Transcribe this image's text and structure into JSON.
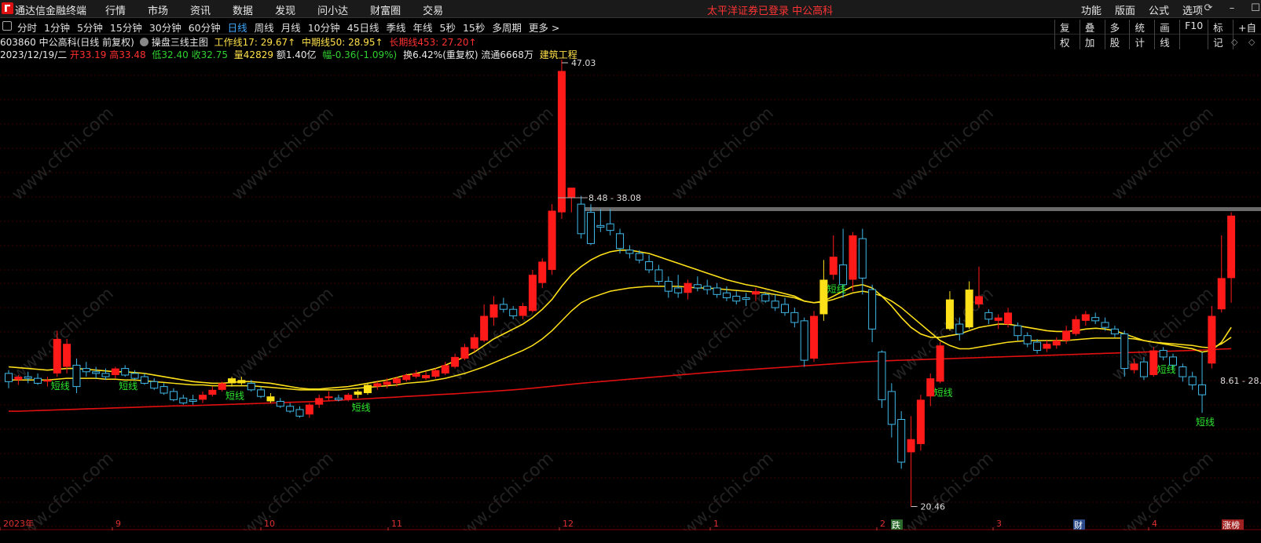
{
  "app": {
    "title": "通达信金融终端"
  },
  "main_menu": [
    "行情",
    "市场",
    "资讯",
    "数据",
    "发现",
    "问小达",
    "财富圈",
    "交易"
  ],
  "notice": "太平洋证券已登录  中公高科",
  "right_menu": [
    "功能",
    "版面",
    "公式",
    "选项"
  ],
  "period_tabs": [
    "分时",
    "1分钟",
    "5分钟",
    "15分钟",
    "30分钟",
    "60分钟",
    "日线",
    "周线",
    "月线",
    "10分钟",
    "45日线",
    "季线",
    "年线",
    "5秒",
    "15秒",
    "多周期",
    "更多 >"
  ],
  "active_period": "日线",
  "tool_buttons": [
    "复权",
    "叠加",
    "多股",
    "统计",
    "画线",
    "F10",
    "标记",
    "+自"
  ],
  "stock": {
    "code_name": "603860 中公高科(日线 前复权)",
    "indicator": "操盘三线主图",
    "work_line": "工作线17: 29.67↑",
    "mid_line": "中期线50: 28.95↑",
    "long_line": "长期线453: 27.20↑",
    "date": "2023/12/19/二",
    "open": "开33.19",
    "high": "高33.48",
    "low": "低32.40",
    "close": "收32.75",
    "volume": "量42829",
    "amount": "额1.40亿",
    "change": "幅-0.36(-1.09%)",
    "turnover": "换6.42%(重复权)",
    "float": "流通6668万",
    "sector": "建筑工程"
  },
  "annotations": {
    "high_mark": "47.03",
    "low_mark": "20.46",
    "range_top": "8.48 - 38.08",
    "range_right": "8.61 - 28.",
    "short_line": "短线"
  },
  "x_labels": [
    "2023年",
    "9",
    "10",
    "11",
    "12",
    "1",
    "2",
    "3",
    "4"
  ],
  "event_badges": [
    "跌",
    "财",
    "涨榜"
  ],
  "watermark": "www.cfchi.com",
  "colors": {
    "up": "#ff1a1a",
    "down": "#3fb8e8",
    "yellow": "#ffe11a",
    "long_line": "#e01010",
    "short_label": "#2ee82e"
  },
  "chart_data": {
    "type": "candlestick",
    "ylim": [
      20.0,
      47.5
    ],
    "candles": [
      {
        "o": 28.6,
        "h": 28.8,
        "l": 27.7,
        "c": 28.1
      },
      {
        "o": 28.2,
        "h": 28.5,
        "l": 27.9,
        "c": 28.4
      },
      {
        "o": 28.4,
        "h": 28.7,
        "l": 28.0,
        "c": 28.3
      },
      {
        "o": 28.3,
        "h": 28.6,
        "l": 27.9,
        "c": 28.0
      },
      {
        "o": 28.1,
        "h": 28.4,
        "l": 27.8,
        "c": 28.2
      },
      {
        "o": 28.6,
        "h": 31.2,
        "l": 28.4,
        "c": 30.7
      },
      {
        "o": 29.0,
        "h": 30.7,
        "l": 28.6,
        "c": 30.4
      },
      {
        "o": 29.1,
        "h": 29.5,
        "l": 27.4,
        "c": 27.8
      },
      {
        "o": 28.9,
        "h": 29.3,
        "l": 28.4,
        "c": 28.7
      },
      {
        "o": 28.7,
        "h": 29.0,
        "l": 28.3,
        "c": 28.6
      },
      {
        "o": 28.6,
        "h": 28.9,
        "l": 28.2,
        "c": 28.4
      },
      {
        "o": 28.5,
        "h": 29.0,
        "l": 28.3,
        "c": 28.9
      },
      {
        "o": 28.9,
        "h": 29.1,
        "l": 28.4,
        "c": 28.5
      },
      {
        "o": 28.6,
        "h": 28.8,
        "l": 28.2,
        "c": 28.3
      },
      {
        "o": 28.4,
        "h": 28.6,
        "l": 27.9,
        "c": 28.0
      },
      {
        "o": 28.1,
        "h": 28.3,
        "l": 27.6,
        "c": 27.7
      },
      {
        "o": 27.8,
        "h": 28.0,
        "l": 27.3,
        "c": 27.4
      },
      {
        "o": 27.5,
        "h": 27.7,
        "l": 26.9,
        "c": 27.0
      },
      {
        "o": 27.1,
        "h": 27.3,
        "l": 26.7,
        "c": 26.8
      },
      {
        "o": 27.0,
        "h": 27.3,
        "l": 26.7,
        "c": 26.9
      },
      {
        "o": 27.0,
        "h": 27.5,
        "l": 26.8,
        "c": 27.3
      },
      {
        "o": 27.3,
        "h": 27.8,
        "l": 27.2,
        "c": 27.6
      },
      {
        "o": 27.6,
        "h": 28.1,
        "l": 27.5,
        "c": 28.0
      },
      {
        "o": 28.0,
        "h": 28.4,
        "l": 27.8,
        "c": 28.3
      },
      {
        "o": 28.2,
        "h": 28.4,
        "l": 27.9,
        "c": 28.0
      },
      {
        "o": 28.0,
        "h": 28.2,
        "l": 27.5,
        "c": 27.6
      },
      {
        "o": 27.6,
        "h": 27.8,
        "l": 27.1,
        "c": 27.2
      },
      {
        "o": 27.2,
        "h": 27.4,
        "l": 26.8,
        "c": 26.9
      },
      {
        "o": 26.9,
        "h": 27.1,
        "l": 26.5,
        "c": 26.6
      },
      {
        "o": 26.6,
        "h": 26.8,
        "l": 26.2,
        "c": 26.3
      },
      {
        "o": 26.4,
        "h": 26.6,
        "l": 25.9,
        "c": 26.0
      },
      {
        "o": 26.1,
        "h": 26.8,
        "l": 25.9,
        "c": 26.7
      },
      {
        "o": 26.7,
        "h": 27.3,
        "l": 26.5,
        "c": 27.1
      },
      {
        "o": 27.1,
        "h": 27.5,
        "l": 26.9,
        "c": 27.2
      },
      {
        "o": 27.1,
        "h": 27.3,
        "l": 26.9,
        "c": 27.0
      },
      {
        "o": 27.0,
        "h": 27.4,
        "l": 26.9,
        "c": 27.3
      },
      {
        "o": 27.3,
        "h": 27.6,
        "l": 27.1,
        "c": 27.5
      },
      {
        "o": 27.4,
        "h": 28.0,
        "l": 27.3,
        "c": 27.9
      },
      {
        "o": 27.8,
        "h": 28.1,
        "l": 27.6,
        "c": 28.0
      },
      {
        "o": 27.9,
        "h": 28.3,
        "l": 27.7,
        "c": 28.1
      },
      {
        "o": 28.0,
        "h": 28.4,
        "l": 27.8,
        "c": 28.3
      },
      {
        "o": 28.2,
        "h": 28.6,
        "l": 28.1,
        "c": 28.5
      },
      {
        "o": 28.4,
        "h": 28.8,
        "l": 28.3,
        "c": 28.6
      },
      {
        "o": 28.3,
        "h": 28.7,
        "l": 28.2,
        "c": 28.5
      },
      {
        "o": 28.4,
        "h": 28.9,
        "l": 28.3,
        "c": 28.8
      },
      {
        "o": 28.6,
        "h": 29.3,
        "l": 28.5,
        "c": 29.1
      },
      {
        "o": 29.0,
        "h": 29.8,
        "l": 28.9,
        "c": 29.6
      },
      {
        "o": 29.5,
        "h": 30.4,
        "l": 29.4,
        "c": 30.2
      },
      {
        "o": 30.1,
        "h": 31.0,
        "l": 29.9,
        "c": 30.8
      },
      {
        "o": 30.6,
        "h": 32.8,
        "l": 30.5,
        "c": 32.1
      },
      {
        "o": 32.0,
        "h": 33.3,
        "l": 31.5,
        "c": 32.8
      },
      {
        "o": 32.8,
        "h": 33.2,
        "l": 32.3,
        "c": 32.5
      },
      {
        "o": 32.5,
        "h": 32.7,
        "l": 31.9,
        "c": 32.1
      },
      {
        "o": 32.1,
        "h": 32.9,
        "l": 31.9,
        "c": 32.7
      },
      {
        "o": 32.4,
        "h": 34.9,
        "l": 32.3,
        "c": 34.6
      },
      {
        "o": 34.1,
        "h": 35.6,
        "l": 33.8,
        "c": 35.4
      },
      {
        "o": 34.9,
        "h": 38.9,
        "l": 34.6,
        "c": 38.5
      },
      {
        "o": 38.4,
        "h": 48.5,
        "l": 38.0,
        "c": 47.0
      },
      {
        "o": 39.3,
        "h": 39.9,
        "l": 38.4,
        "c": 39.9
      },
      {
        "o": 38.9,
        "h": 39.4,
        "l": 36.8,
        "c": 37.1
      },
      {
        "o": 38.4,
        "h": 38.9,
        "l": 36.4,
        "c": 36.5
      },
      {
        "o": 37.6,
        "h": 38.6,
        "l": 37.2,
        "c": 37.5
      },
      {
        "o": 37.7,
        "h": 38.6,
        "l": 37.0,
        "c": 37.3
      },
      {
        "o": 37.1,
        "h": 37.4,
        "l": 35.9,
        "c": 36.2
      },
      {
        "o": 36.1,
        "h": 36.4,
        "l": 35.6,
        "c": 35.9
      },
      {
        "o": 35.9,
        "h": 36.1,
        "l": 35.3,
        "c": 35.5
      },
      {
        "o": 35.4,
        "h": 35.8,
        "l": 34.7,
        "c": 34.9
      },
      {
        "o": 34.9,
        "h": 35.2,
        "l": 34.0,
        "c": 34.2
      },
      {
        "o": 34.2,
        "h": 34.5,
        "l": 33.2,
        "c": 33.6
      },
      {
        "o": 33.8,
        "h": 34.6,
        "l": 33.2,
        "c": 33.5
      },
      {
        "o": 33.5,
        "h": 34.3,
        "l": 33.1,
        "c": 34.1
      },
      {
        "o": 34.0,
        "h": 34.5,
        "l": 33.6,
        "c": 33.8
      },
      {
        "o": 33.9,
        "h": 34.3,
        "l": 33.4,
        "c": 33.7
      },
      {
        "o": 33.8,
        "h": 34.1,
        "l": 33.2,
        "c": 33.4
      },
      {
        "o": 33.5,
        "h": 33.9,
        "l": 33.0,
        "c": 33.2
      },
      {
        "o": 33.3,
        "h": 33.6,
        "l": 32.8,
        "c": 33.0
      },
      {
        "o": 33.2,
        "h": 33.5,
        "l": 32.7,
        "c": 33.1
      },
      {
        "o": 33.4,
        "h": 33.8,
        "l": 33.0,
        "c": 33.6
      },
      {
        "o": 33.4,
        "h": 33.5,
        "l": 32.9,
        "c": 33.0
      },
      {
        "o": 33.0,
        "h": 33.4,
        "l": 32.4,
        "c": 32.6
      },
      {
        "o": 32.8,
        "h": 33.2,
        "l": 32.1,
        "c": 32.3
      },
      {
        "o": 32.3,
        "h": 32.6,
        "l": 31.4,
        "c": 31.7
      },
      {
        "o": 31.8,
        "h": 32.0,
        "l": 29.0,
        "c": 29.4
      },
      {
        "o": 29.5,
        "h": 32.4,
        "l": 29.3,
        "c": 32.1
      },
      {
        "o": 32.2,
        "h": 35.5,
        "l": 31.8,
        "c": 34.3
      },
      {
        "o": 34.6,
        "h": 37.0,
        "l": 34.3,
        "c": 35.7
      },
      {
        "o": 35.2,
        "h": 37.4,
        "l": 33.2,
        "c": 34.0
      },
      {
        "o": 34.3,
        "h": 37.2,
        "l": 33.6,
        "c": 37.0
      },
      {
        "o": 36.8,
        "h": 37.4,
        "l": 33.4,
        "c": 34.4
      },
      {
        "o": 33.7,
        "h": 34.0,
        "l": 30.5,
        "c": 31.3
      },
      {
        "o": 29.9,
        "h": 30.0,
        "l": 26.5,
        "c": 27.0
      },
      {
        "o": 27.5,
        "h": 28.0,
        "l": 24.7,
        "c": 25.5
      },
      {
        "o": 25.8,
        "h": 26.3,
        "l": 22.8,
        "c": 23.2
      },
      {
        "o": 23.8,
        "h": 26.0,
        "l": 20.5,
        "c": 24.6
      },
      {
        "o": 24.3,
        "h": 27.3,
        "l": 23.9,
        "c": 27.0
      },
      {
        "o": 27.2,
        "h": 28.6,
        "l": 26.6,
        "c": 28.3
      },
      {
        "o": 28.1,
        "h": 30.5,
        "l": 28.0,
        "c": 30.3
      },
      {
        "o": 31.3,
        "h": 33.6,
        "l": 31.2,
        "c": 33.1
      },
      {
        "o": 31.6,
        "h": 32.0,
        "l": 30.6,
        "c": 31.0
      },
      {
        "o": 31.4,
        "h": 34.2,
        "l": 31.3,
        "c": 33.7
      },
      {
        "o": 32.8,
        "h": 35.1,
        "l": 32.6,
        "c": 33.3
      },
      {
        "o": 32.3,
        "h": 32.5,
        "l": 31.6,
        "c": 31.9
      },
      {
        "o": 31.8,
        "h": 32.2,
        "l": 31.3,
        "c": 32.0
      },
      {
        "o": 31.6,
        "h": 32.6,
        "l": 31.4,
        "c": 32.3
      },
      {
        "o": 31.5,
        "h": 31.7,
        "l": 30.6,
        "c": 30.9
      },
      {
        "o": 30.9,
        "h": 31.1,
        "l": 30.2,
        "c": 30.4
      },
      {
        "o": 30.5,
        "h": 30.7,
        "l": 29.8,
        "c": 30.0
      },
      {
        "o": 30.1,
        "h": 30.6,
        "l": 29.9,
        "c": 30.4
      },
      {
        "o": 30.3,
        "h": 30.8,
        "l": 30.1,
        "c": 30.6
      },
      {
        "o": 30.6,
        "h": 31.5,
        "l": 30.4,
        "c": 31.2
      },
      {
        "o": 31.0,
        "h": 32.1,
        "l": 30.9,
        "c": 31.9
      },
      {
        "o": 31.8,
        "h": 32.4,
        "l": 31.5,
        "c": 32.2
      },
      {
        "o": 32.0,
        "h": 32.3,
        "l": 31.6,
        "c": 31.8
      },
      {
        "o": 31.7,
        "h": 32.0,
        "l": 31.2,
        "c": 31.4
      },
      {
        "o": 31.3,
        "h": 31.5,
        "l": 30.8,
        "c": 31.0
      },
      {
        "o": 31.0,
        "h": 31.2,
        "l": 28.4,
        "c": 28.9
      },
      {
        "o": 28.8,
        "h": 29.5,
        "l": 28.6,
        "c": 29.2
      },
      {
        "o": 29.3,
        "h": 29.6,
        "l": 28.2,
        "c": 28.4
      },
      {
        "o": 28.5,
        "h": 30.2,
        "l": 28.4,
        "c": 30.0
      },
      {
        "o": 30.0,
        "h": 30.2,
        "l": 29.4,
        "c": 29.6
      },
      {
        "o": 29.6,
        "h": 29.8,
        "l": 28.8,
        "c": 29.1
      },
      {
        "o": 29.0,
        "h": 29.2,
        "l": 28.1,
        "c": 28.4
      },
      {
        "o": 28.4,
        "h": 28.7,
        "l": 27.6,
        "c": 27.9
      },
      {
        "o": 27.9,
        "h": 29.9,
        "l": 26.2,
        "c": 27.3
      },
      {
        "o": 29.2,
        "h": 32.7,
        "l": 28.9,
        "c": 32.1
      },
      {
        "o": 32.5,
        "h": 37.0,
        "l": 32.3,
        "c": 34.4
      },
      {
        "o": 34.4,
        "h": 38.4,
        "l": 32.9,
        "c": 38.2
      }
    ],
    "work_line": [
      29.0,
      28.95,
      28.9,
      28.85,
      28.8,
      28.85,
      28.9,
      28.9,
      28.85,
      28.8,
      28.75,
      28.7,
      28.7,
      28.65,
      28.6,
      28.5,
      28.4,
      28.3,
      28.2,
      28.1,
      28.05,
      28.0,
      28.0,
      28.05,
      28.1,
      28.1,
      28.05,
      28.0,
      27.9,
      27.8,
      27.7,
      27.65,
      27.65,
      27.7,
      27.75,
      27.8,
      27.9,
      28.0,
      28.1,
      28.2,
      28.35,
      28.5,
      28.6,
      28.75,
      28.9,
      29.1,
      29.35,
      29.6,
      29.9,
      30.3,
      30.7,
      31.0,
      31.3,
      31.6,
      32.0,
      32.5,
      33.1,
      33.9,
      34.6,
      35.1,
      35.5,
      35.8,
      36.0,
      36.1,
      36.1,
      36.0,
      35.9,
      35.7,
      35.5,
      35.3,
      35.1,
      34.9,
      34.7,
      34.5,
      34.3,
      34.15,
      34.0,
      33.9,
      33.75,
      33.6,
      33.45,
      33.3,
      33.0,
      32.9,
      33.0,
      33.3,
      33.6,
      33.9,
      34.0,
      33.8,
      33.3,
      32.7,
      32.0,
      31.4,
      31.0,
      30.8,
      30.8,
      30.9,
      31.0,
      31.2,
      31.4,
      31.5,
      31.6,
      31.6,
      31.5,
      31.4,
      31.3,
      31.2,
      31.15,
      31.15,
      31.2,
      31.3,
      31.35,
      31.3,
      31.2,
      31.0,
      30.8,
      30.6,
      30.5,
      30.4,
      30.3,
      30.2,
      30.1,
      29.9,
      30.0,
      30.5,
      31.4
    ],
    "mid_line": [
      28.2,
      28.2,
      28.2,
      28.2,
      28.2,
      28.25,
      28.3,
      28.3,
      28.3,
      28.3,
      28.25,
      28.25,
      28.2,
      28.2,
      28.15,
      28.1,
      28.05,
      28.0,
      27.95,
      27.9,
      27.9,
      27.85,
      27.85,
      27.85,
      27.85,
      27.85,
      27.8,
      27.75,
      27.7,
      27.65,
      27.6,
      27.6,
      27.6,
      27.6,
      27.6,
      27.65,
      27.7,
      27.75,
      27.8,
      27.85,
      27.9,
      28.0,
      28.05,
      28.1,
      28.2,
      28.3,
      28.45,
      28.6,
      28.8,
      29.0,
      29.25,
      29.5,
      29.75,
      30.0,
      30.3,
      30.7,
      31.2,
      31.8,
      32.4,
      32.9,
      33.2,
      33.4,
      33.6,
      33.7,
      33.8,
      33.85,
      33.9,
      33.9,
      33.9,
      33.9,
      33.85,
      33.8,
      33.8,
      33.75,
      33.7,
      33.65,
      33.6,
      33.55,
      33.5,
      33.4,
      33.3,
      33.2,
      33.0,
      32.9,
      32.95,
      33.1,
      33.3,
      33.5,
      33.6,
      33.5,
      33.3,
      33.0,
      32.6,
      32.1,
      31.6,
      31.1,
      30.6,
      30.3,
      30.1,
      30.1,
      30.2,
      30.3,
      30.4,
      30.5,
      30.55,
      30.6,
      30.6,
      30.6,
      30.6,
      30.6,
      30.65,
      30.7,
      30.75,
      30.75,
      30.75,
      30.75,
      30.7,
      30.6,
      30.5,
      30.45,
      30.4,
      30.35,
      30.3,
      30.2,
      30.15,
      30.4,
      30.8
    ],
    "long_line": [
      26.3,
      26.3,
      26.32,
      26.34,
      26.36,
      26.38,
      26.4,
      26.42,
      26.44,
      26.46,
      26.48,
      26.5,
      26.52,
      26.54,
      26.56,
      26.58,
      26.6,
      26.62,
      26.63,
      26.64,
      26.66,
      26.68,
      26.7,
      26.72,
      26.74,
      26.76,
      26.78,
      26.8,
      26.82,
      26.84,
      26.86,
      26.88,
      26.9,
      26.93,
      26.96,
      27.0,
      27.03,
      27.06,
      27.1,
      27.13,
      27.16,
      27.2,
      27.23,
      27.26,
      27.3,
      27.33,
      27.36,
      27.4,
      27.44,
      27.48,
      27.52,
      27.56,
      27.6,
      27.65,
      27.7,
      27.76,
      27.82,
      27.88,
      27.94,
      28.0,
      28.05,
      28.1,
      28.15,
      28.2,
      28.25,
      28.3,
      28.35,
      28.4,
      28.45,
      28.5,
      28.55,
      28.6,
      28.65,
      28.7,
      28.74,
      28.78,
      28.82,
      28.86,
      28.9,
      28.94,
      28.98,
      29.02,
      29.06,
      29.1,
      29.14,
      29.18,
      29.22,
      29.26,
      29.3,
      29.33,
      29.36,
      29.38,
      29.4,
      29.42,
      29.44,
      29.46,
      29.48,
      29.5,
      29.52,
      29.54,
      29.56,
      29.58,
      29.6,
      29.62,
      29.64,
      29.66,
      29.68,
      29.7,
      29.72,
      29.74,
      29.76,
      29.78,
      29.8,
      29.82,
      29.84,
      29.86,
      29.88,
      29.9,
      29.92,
      29.94,
      29.96,
      29.98,
      30.0,
      30.02,
      30.05,
      30.08,
      30.1
    ]
  }
}
